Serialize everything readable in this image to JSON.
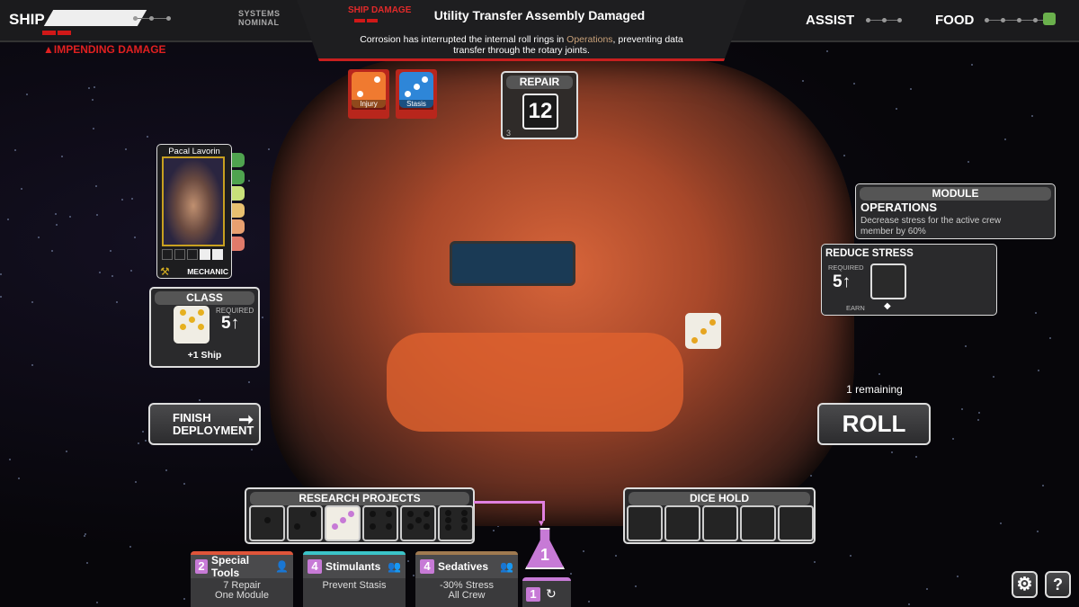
{
  "topbar": {
    "ship_label": "SHIP",
    "systems_status": "SYSTEMS NOMINAL",
    "impending": "IMPENDING DAMAGE",
    "assist_label": "ASSIST",
    "food_label": "FOOD"
  },
  "damage": {
    "label": "SHIP DAMAGE",
    "title": "Utility Transfer Assembly Damaged",
    "desc_pre": "Corrosion has interrupted the internal roll rings in ",
    "desc_highlight": "Operations",
    "desc_post": ", preventing data transfer through the rotary joints.",
    "highlight_color": "#c9a27a",
    "threats": [
      {
        "label": "Injury",
        "color": "#f07a30",
        "pips": 2
      },
      {
        "label": "Stasis",
        "color": "#2e86d8",
        "pips": 3
      }
    ]
  },
  "repair": {
    "label": "REPAIR",
    "value": "12",
    "sub": "3"
  },
  "crew": {
    "name": "Pacal Lavorin",
    "role": "MECHANIC",
    "tool_icon": "wrench-icon",
    "stress_colors": [
      "#4fa34f",
      "#4fa34f",
      "#c8e07a",
      "#e8c070",
      "#e8a070",
      "#e07a6a"
    ]
  },
  "class_panel": {
    "label": "CLASS",
    "required_label": "REQUIRED",
    "required": "5↑",
    "reward": "+1 Ship",
    "die_pips": 5
  },
  "finish": {
    "label_line1": "FINISH",
    "label_line2": "DEPLOYMENT"
  },
  "module": {
    "label": "MODULE",
    "name": "OPERATIONS",
    "desc": "Decrease stress for the active crew member by 60%"
  },
  "reduce_stress": {
    "label": "REDUCE STRESS",
    "required_label": "REQUIRED",
    "required": "5↑",
    "earn_label": "EARN"
  },
  "scene_die_pips": 3,
  "roll": {
    "remaining": "1 remaining",
    "label": "ROLL"
  },
  "research": {
    "label": "RESEARCH PROJECTS",
    "dice": [
      1,
      2,
      3,
      4,
      5,
      6
    ],
    "active_index": 2,
    "flask_count": "1",
    "reroll_count": "1"
  },
  "dice_hold": {
    "label": "DICE HOLD",
    "slots": 5
  },
  "cards": [
    {
      "cost": "2",
      "title": "Special Tools",
      "line1": "7 Repair",
      "line2": "One Module",
      "color": "#e0553a",
      "icon": "single-crew-icon"
    },
    {
      "cost": "4",
      "title": "Stimulants",
      "line1": "Prevent Stasis",
      "line2": "",
      "color": "#3bc4c8",
      "icon": "all-crew-icon"
    },
    {
      "cost": "4",
      "title": "Sedatives",
      "line1": "-30% Stress",
      "line2": "All Crew",
      "color": "#a07a50",
      "icon": "all-crew-icon"
    }
  ],
  "buttons": {
    "settings": "settings",
    "help": "?"
  }
}
